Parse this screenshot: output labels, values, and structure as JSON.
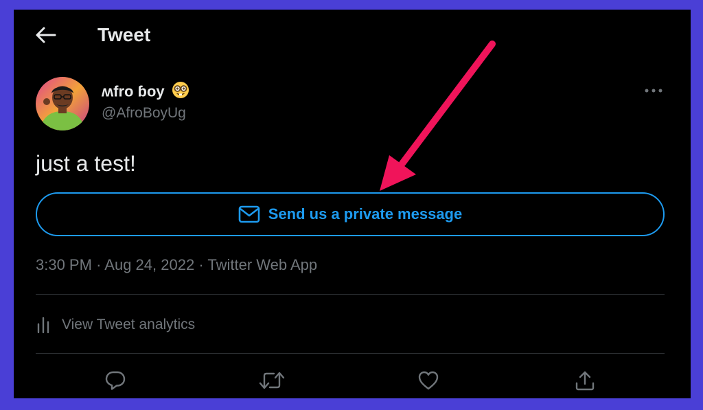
{
  "header": {
    "title": "Tweet",
    "back_icon": "arrow-left-icon"
  },
  "tweet": {
    "author_name": "ʍfro ɓoy",
    "author_emoji": "nerd-face-emoji",
    "author_handle": "@AfroBoyUg",
    "text": "just a test!",
    "dm_button_label": "Send us a private message",
    "time": "3:30 PM",
    "separator": "·",
    "date": "Aug 24, 2022",
    "source": "Twitter Web App",
    "analytics_label": "View Tweet analytics"
  },
  "actions": {
    "reply_icon": "reply-icon",
    "retweet_icon": "retweet-icon",
    "like_icon": "heart-icon",
    "share_icon": "share-icon"
  },
  "colors": {
    "accent": "#1d9bf0",
    "annotation_arrow": "#f0145a",
    "frame_border": "#4a3fd6",
    "background": "#000000",
    "secondary_text": "#71767b"
  }
}
